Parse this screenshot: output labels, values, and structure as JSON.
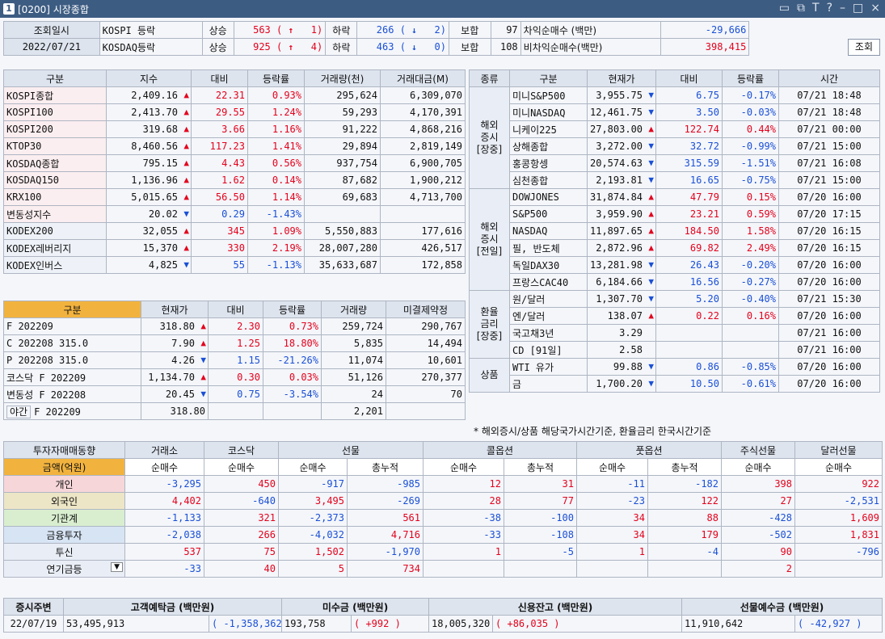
{
  "window": {
    "badge": "1",
    "title": "[0200] 시장종합"
  },
  "top": {
    "date_label": "조회일시",
    "date_value": "2022/07/21",
    "rows": [
      {
        "market": "KOSPI 등락",
        "up_label": "상승",
        "up": "563",
        "up_arrow": "↑",
        "up_limit": "1",
        "down_label": "하락",
        "down": "266",
        "down_arrow": "↓",
        "down_limit": "2",
        "flat_label": "보합",
        "flat": "97"
      },
      {
        "market": "KOSDAQ등락",
        "up_label": "상승",
        "up": "925",
        "up_arrow": "↑",
        "up_limit": "4",
        "down_label": "하락",
        "down": "463",
        "down_arrow": "↓",
        "down_limit": "0",
        "flat_label": "보합",
        "flat": "108"
      }
    ],
    "arb": [
      {
        "label": "차익순매수 (백만)",
        "value": "-29,666"
      },
      {
        "label": "비차익순매수(백만)",
        "value": "398,415"
      }
    ],
    "query_button": "조회"
  },
  "index_table": {
    "headers": [
      "구분",
      "지수",
      "대비",
      "등락률",
      "거래량(천)",
      "거래대금(M)"
    ],
    "rows": [
      {
        "name": "KOSPI종합",
        "value": "2,409.16",
        "dir": "up",
        "diff": "22.31",
        "rate": "0.93%",
        "vol": "295,624",
        "amt": "6,309,070"
      },
      {
        "name": "KOSPI100",
        "value": "2,413.70",
        "dir": "up",
        "diff": "29.55",
        "rate": "1.24%",
        "vol": "59,293",
        "amt": "4,170,391"
      },
      {
        "name": "KOSPI200",
        "value": "319.68",
        "dir": "up",
        "diff": "3.66",
        "rate": "1.16%",
        "vol": "91,222",
        "amt": "4,868,216"
      },
      {
        "name": "KTOP30",
        "value": "8,460.56",
        "dir": "up",
        "diff": "117.23",
        "rate": "1.41%",
        "vol": "29,894",
        "amt": "2,819,149"
      },
      {
        "name": "KOSDAQ종합",
        "value": "795.15",
        "dir": "up",
        "diff": "4.43",
        "rate": "0.56%",
        "vol": "937,754",
        "amt": "6,900,705"
      },
      {
        "name": "KOSDAQ150",
        "value": "1,136.96",
        "dir": "up",
        "diff": "1.62",
        "rate": "0.14%",
        "vol": "87,682",
        "amt": "1,900,212"
      },
      {
        "name": "KRX100",
        "value": "5,015.65",
        "dir": "up",
        "diff": "56.50",
        "rate": "1.14%",
        "vol": "69,683",
        "amt": "4,713,700"
      },
      {
        "name": "변동성지수",
        "value": "20.02",
        "dir": "dn",
        "diff": "0.29",
        "rate": "-1.43%",
        "vol": "",
        "amt": ""
      },
      {
        "name": "KODEX200",
        "value": "32,055",
        "dir": "up",
        "diff": "345",
        "rate": "1.09%",
        "vol": "5,550,883",
        "amt": "177,616"
      },
      {
        "name": "KODEX레버리지",
        "value": "15,370",
        "dir": "up",
        "diff": "330",
        "rate": "2.19%",
        "vol": "28,007,280",
        "amt": "426,517"
      },
      {
        "name": "KODEX인버스",
        "value": "4,825",
        "dir": "dn",
        "diff": "55",
        "rate": "-1.13%",
        "vol": "35,633,687",
        "amt": "172,858"
      }
    ]
  },
  "deriv_table": {
    "headers": [
      "구분",
      "현재가",
      "대비",
      "등락률",
      "거래량",
      "미결제약정"
    ],
    "rows": [
      {
        "name": "F 202209",
        "value": "318.80",
        "dir": "up",
        "diff": "2.30",
        "rate": "0.73%",
        "vol": "259,724",
        "oi": "290,767"
      },
      {
        "name": "C 202208 315.0",
        "value": "7.90",
        "dir": "up",
        "diff": "1.25",
        "rate": "18.80%",
        "vol": "5,835",
        "oi": "14,494"
      },
      {
        "name": "P 202208 315.0",
        "value": "4.26",
        "dir": "dn",
        "diff": "1.15",
        "rate": "-21.26%",
        "vol": "11,074",
        "oi": "10,601"
      },
      {
        "name": "코스닥 F 202209",
        "value": "1,134.70",
        "dir": "up",
        "diff": "0.30",
        "rate": "0.03%",
        "vol": "51,126",
        "oi": "270,377"
      },
      {
        "name": "변동성 F 202208",
        "value": "20.45",
        "dir": "dn",
        "diff": "0.75",
        "rate": "-3.54%",
        "vol": "24",
        "oi": "70"
      }
    ],
    "night": {
      "tag": "야간",
      "name": "F 202209",
      "value": "318.80",
      "vol": "2,201"
    }
  },
  "world_table": {
    "headers": [
      "종류",
      "구분",
      "현재가",
      "대비",
      "등락률",
      "시간"
    ],
    "groups": [
      {
        "label": "해외\n증시\n[장중]",
        "rows": [
          {
            "name": "미니S&P500",
            "value": "3,955.75",
            "dir": "dn",
            "diff": "6.75",
            "rate": "-0.17%",
            "time": "07/21 18:48"
          },
          {
            "name": "미니NASDAQ",
            "value": "12,461.75",
            "dir": "dn",
            "diff": "3.50",
            "rate": "-0.03%",
            "time": "07/21 18:48"
          },
          {
            "name": "니케이225",
            "value": "27,803.00",
            "dir": "up",
            "diff": "122.74",
            "rate": "0.44%",
            "time": "07/21 00:00"
          },
          {
            "name": "상해종합",
            "value": "3,272.00",
            "dir": "dn",
            "diff": "32.72",
            "rate": "-0.99%",
            "time": "07/21 15:00"
          },
          {
            "name": "홍콩항셍",
            "value": "20,574.63",
            "dir": "dn",
            "diff": "315.59",
            "rate": "-1.51%",
            "time": "07/21 16:08"
          },
          {
            "name": "심천종합",
            "value": "2,193.81",
            "dir": "dn",
            "diff": "16.65",
            "rate": "-0.75%",
            "time": "07/21 15:00"
          }
        ]
      },
      {
        "label": "해외\n증시\n[전일]",
        "rows": [
          {
            "name": "DOWJONES",
            "value": "31,874.84",
            "dir": "up",
            "diff": "47.79",
            "rate": "0.15%",
            "time": "07/20 16:00"
          },
          {
            "name": "S&P500",
            "value": "3,959.90",
            "dir": "up",
            "diff": "23.21",
            "rate": "0.59%",
            "time": "07/20 17:15"
          },
          {
            "name": "NASDAQ",
            "value": "11,897.65",
            "dir": "up",
            "diff": "184.50",
            "rate": "1.58%",
            "time": "07/20 16:15"
          },
          {
            "name": "필, 반도체",
            "value": "2,872.96",
            "dir": "up",
            "diff": "69.82",
            "rate": "2.49%",
            "time": "07/20 16:15"
          },
          {
            "name": "독일DAX30",
            "value": "13,281.98",
            "dir": "dn",
            "diff": "26.43",
            "rate": "-0.20%",
            "time": "07/20 16:00"
          },
          {
            "name": "프랑스CAC40",
            "value": "6,184.66",
            "dir": "dn",
            "diff": "16.56",
            "rate": "-0.27%",
            "time": "07/20 16:00"
          }
        ]
      },
      {
        "label": "환율\n금리\n[장중]",
        "rows": [
          {
            "name": "원/달러",
            "value": "1,307.70",
            "dir": "dn",
            "diff": "5.20",
            "rate": "-0.40%",
            "time": "07/21 15:30"
          },
          {
            "name": "엔/달러",
            "value": "138.07",
            "dir": "up",
            "diff": "0.22",
            "rate": "0.16%",
            "time": "07/20 16:00"
          },
          {
            "name": "국고채3년",
            "value": "3.29",
            "dir": "",
            "diff": "",
            "rate": "",
            "time": "07/21 16:00"
          },
          {
            "name": "CD [91일]",
            "value": "2.58",
            "dir": "",
            "diff": "",
            "rate": "",
            "time": "07/21 16:00"
          }
        ]
      },
      {
        "label": "상품",
        "rows": [
          {
            "name": "WTI 유가",
            "value": "99.88",
            "dir": "dn",
            "diff": "0.86",
            "rate": "-0.85%",
            "time": "07/20 16:00"
          },
          {
            "name": "금",
            "value": "1,700.20",
            "dir": "dn",
            "diff": "10.50",
            "rate": "-0.61%",
            "time": "07/20 16:00"
          }
        ]
      }
    ],
    "note": "* 해외증시/상품 해당국가시간기준, 환율금리 한국시간기준"
  },
  "flow_table": {
    "corner_top": "투자자매매동향",
    "corner_bottom": "금액(억원)",
    "groups": [
      "거래소",
      "코스닥",
      "선물",
      "콜옵션",
      "풋옵션",
      "주식선물",
      "달러선물"
    ],
    "sub": [
      "순매수",
      "순매수",
      "순매수",
      "총누적",
      "순매수",
      "총누적",
      "순매수",
      "총누적",
      "순매수",
      "순매수"
    ],
    "rows": [
      {
        "name": "개인",
        "cls": "pink",
        "vals": [
          "-3,295",
          "450",
          "-917",
          "-985",
          "12",
          "31",
          "-11",
          "-182",
          "398",
          "922"
        ]
      },
      {
        "name": "외국인",
        "cls": "tan",
        "vals": [
          "4,402",
          "-640",
          "3,495",
          "-269",
          "28",
          "77",
          "-23",
          "122",
          "27",
          "-2,531"
        ]
      },
      {
        "name": "기관계",
        "cls": "grn",
        "vals": [
          "-1,133",
          "321",
          "-2,373",
          "561",
          "-38",
          "-100",
          "34",
          "88",
          "-428",
          "1,609"
        ]
      },
      {
        "name": "금융투자",
        "cls": "blu",
        "vals": [
          "-2,038",
          "266",
          "-4,032",
          "4,716",
          "-33",
          "-108",
          "34",
          "179",
          "-502",
          "1,831"
        ]
      },
      {
        "name": "투신",
        "cls": "lblu",
        "vals": [
          "537",
          "75",
          "1,502",
          "-1,970",
          "1",
          "-5",
          "1",
          "-4",
          "90",
          "-796"
        ]
      },
      {
        "name": "연기금등",
        "cls": "lblu",
        "vals": [
          "-33",
          "40",
          "5",
          "734",
          "",
          "",
          "",
          "",
          "2",
          ""
        ]
      }
    ]
  },
  "deposit": {
    "title": "증시주변",
    "date": "22/07/19",
    "items": [
      {
        "label": "고객예탁금 (백만원)",
        "value": "53,495,913",
        "change": "-1,358,362",
        "dir": "dn"
      },
      {
        "label": "미수금 (백만원)",
        "value": "193,758",
        "change": "+992",
        "dir": "up"
      },
      {
        "label": "신용잔고 (백만원)",
        "value": "18,005,320",
        "change": "+86,035",
        "dir": "up"
      },
      {
        "label": "선물예수금 (백만원)",
        "value": "11,910,642",
        "change": "-42,927",
        "dir": "dn"
      }
    ]
  }
}
